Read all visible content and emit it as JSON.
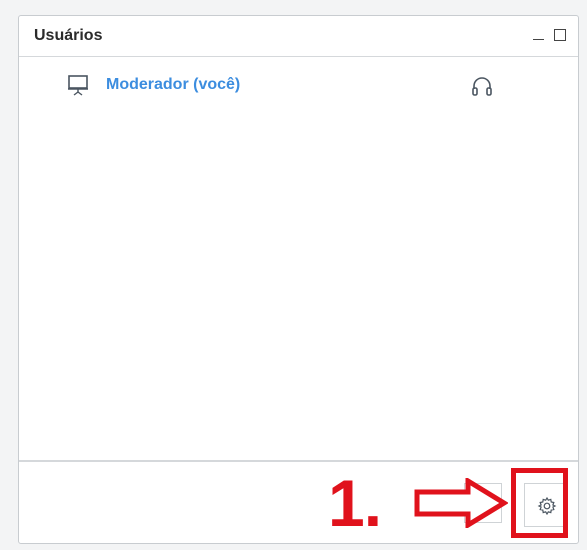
{
  "panel": {
    "title": "Usuários",
    "minimize_icon": "minimize-icon",
    "maximize_icon": "maximize-icon"
  },
  "users": [
    {
      "name": "Moderador (você)",
      "role_icon": "presentation-screen-icon",
      "audio_icon": "headset-icon"
    }
  ],
  "footer": {
    "emoji_icon": "emoji-status-icon",
    "settings_icon": "gear-icon"
  },
  "annotation": {
    "step_label": "1.",
    "color": "#e0121c",
    "pointer_icon": "right-arrow-icon"
  },
  "colors": {
    "user_name": "#3c8ddf",
    "title": "#2b2b2b",
    "border": "#c8ccd0"
  }
}
